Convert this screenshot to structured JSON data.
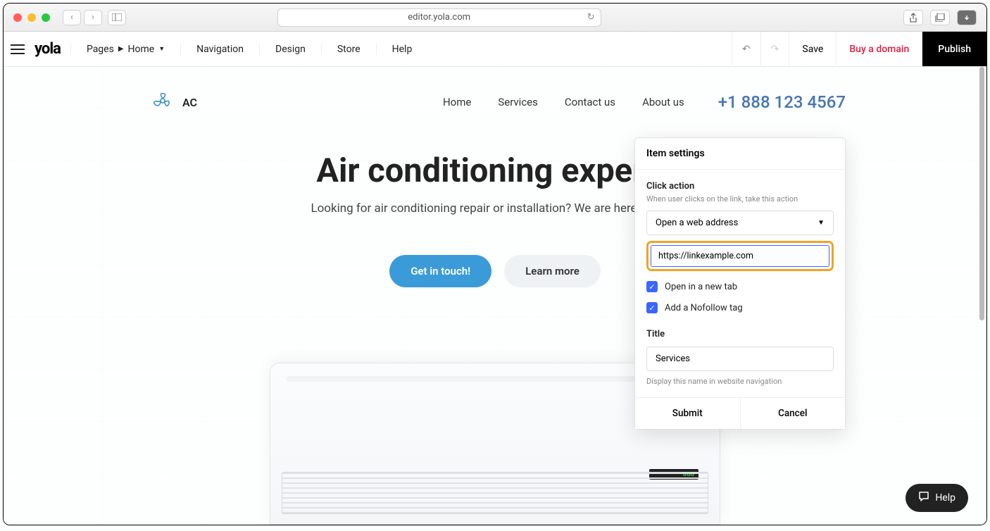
{
  "browser": {
    "url": "editor.yola.com"
  },
  "toolbar": {
    "logo": "yola",
    "pages_label": "Pages",
    "current_page": "Home",
    "nav": [
      "Navigation",
      "Design",
      "Store",
      "Help"
    ],
    "save": "Save",
    "buy_domain": "Buy a domain",
    "publish": "Publish"
  },
  "site": {
    "logo_text": "AC",
    "nav": [
      "Home",
      "Services",
      "Contact us",
      "About us"
    ],
    "phone": "+1 888 123 4567",
    "hero_title": "Air conditioning experts",
    "hero_sub": "Looking for air conditioning repair or installation? We are here to help!",
    "cta_primary": "Get in touch!",
    "cta_secondary": "Learn more"
  },
  "panel": {
    "title": "Item settings",
    "click_action_label": "Click action",
    "click_action_help": "When user clicks on the link, take this action",
    "action_selected": "Open a web address",
    "url_value": "https://linkexample.com",
    "open_new_tab": "Open in a new tab",
    "nofollow": "Add a Nofollow tag",
    "title_label": "Title",
    "title_value": "Services",
    "title_help": "Display this name in website navigation",
    "submit": "Submit",
    "cancel": "Cancel"
  },
  "help_widget": "Help"
}
